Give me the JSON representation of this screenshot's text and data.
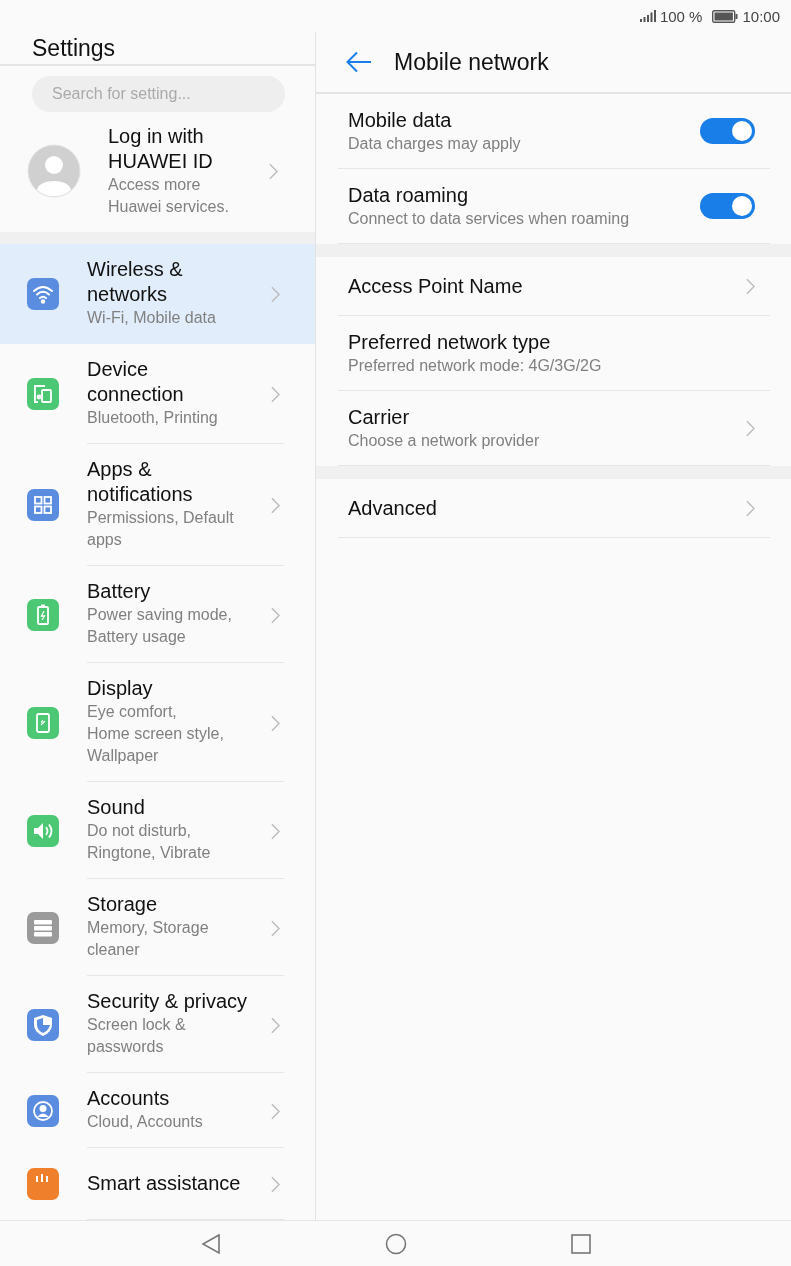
{
  "status_bar": {
    "battery": "100 %",
    "time": "10:00"
  },
  "sidebar": {
    "title": "Settings",
    "search": {
      "placeholder": "Search for setting..."
    },
    "profile": {
      "title": "Log in with HUAWEI ID",
      "subtitle": "Access more Huawei services."
    },
    "items": [
      {
        "title": "Wireless & networks",
        "subtitle": "Wi-Fi, Mobile data",
        "color": "#5a8de0",
        "selected": true
      },
      {
        "title": "Device connection",
        "subtitle": "Bluetooth, Printing",
        "color": "#4cc774",
        "selected": false
      },
      {
        "title": "Apps & notifications",
        "subtitle": "Permissions, Default apps",
        "color": "#5a8de0",
        "selected": false
      },
      {
        "title": "Battery",
        "subtitle": "Power saving mode, Battery usage",
        "color": "#4cc774",
        "selected": false
      },
      {
        "title": "Display",
        "subtitle": "Eye comfort,\nHome screen style,\nWallpaper",
        "color": "#4cc774",
        "selected": false
      },
      {
        "title": "Sound",
        "subtitle": "Do not disturb, Ringtone, Vibrate",
        "color": "#4cc774",
        "selected": false
      },
      {
        "title": "Storage",
        "subtitle": "Memory, Storage cleaner",
        "color": "#9a9a9a",
        "selected": false
      },
      {
        "title": "Security & privacy",
        "subtitle": "Screen lock & passwords",
        "color": "#5a8de0",
        "selected": false
      },
      {
        "title": "Accounts",
        "subtitle": "Cloud, Accounts",
        "color": "#5a8de0",
        "selected": false
      },
      {
        "title": "Smart assistance",
        "color": "#f07f2c",
        "selected": false
      }
    ]
  },
  "detail": {
    "title": "Mobile network",
    "groups": [
      [
        {
          "kind": "toggle",
          "title": "Mobile data",
          "subtitle": "Data charges may apply",
          "on": true
        },
        {
          "kind": "toggle",
          "title": "Data roaming",
          "subtitle": "Connect to data services when roaming",
          "on": true
        }
      ],
      [
        {
          "kind": "link",
          "title": "Access Point Name"
        },
        {
          "kind": "plain",
          "title": "Preferred network type",
          "subtitle": "Preferred network mode: 4G/3G/2G"
        },
        {
          "kind": "link",
          "title": "Carrier",
          "subtitle": "Choose a network provider"
        }
      ],
      [
        {
          "kind": "link",
          "title": "Advanced"
        }
      ]
    ]
  }
}
